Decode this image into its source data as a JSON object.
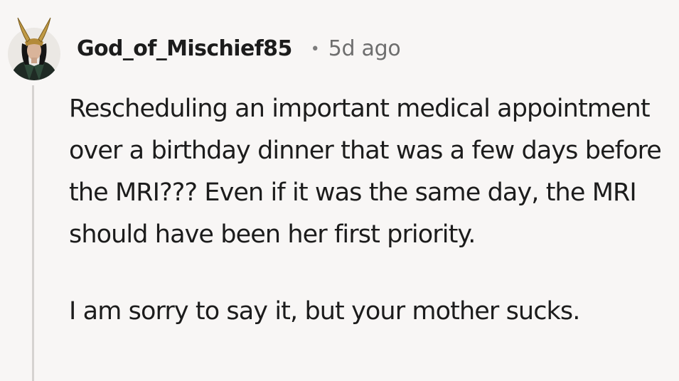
{
  "comment": {
    "author": "God_of_Mischief85",
    "separator": "•",
    "timestamp": "5d ago",
    "avatar_icon": "loki-horned-helmet-avatar-icon",
    "paragraphs": [
      "Rescheduling an important medical appointment over a birthday dinner that was a few days before the MRI??? Even if it was the same day, the MRI should have been her first priority.",
      "I am sorry to say it, but your mother sucks."
    ]
  },
  "colors": {
    "background": "#f8f6f5",
    "text": "#1c1c1c",
    "muted": "#6e6e6e",
    "thread_line": "#d6d3d1"
  }
}
